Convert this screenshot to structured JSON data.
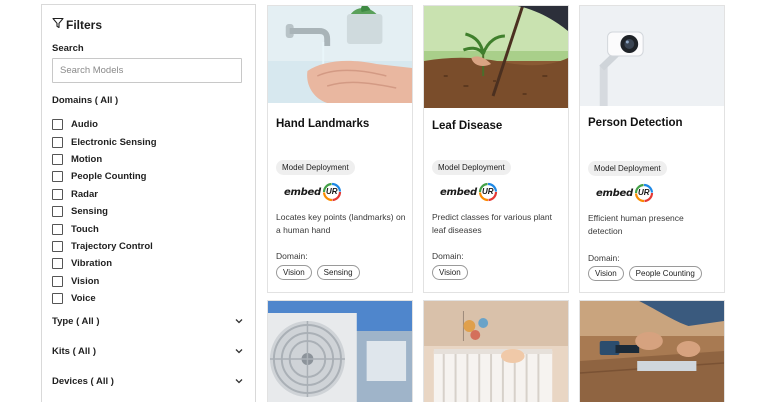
{
  "sidebar": {
    "title": "Filters",
    "search_label": "Search",
    "search_placeholder": "Search Models",
    "domains_heading": "Domains ( All )",
    "domains": [
      "Audio",
      "Electronic Sensing",
      "Motion",
      "People Counting",
      "Radar",
      "Sensing",
      "Touch",
      "Trajectory Control",
      "Vibration",
      "Vision",
      "Voice"
    ],
    "type_label": "Type ( All )",
    "kits_label": "Kits ( All )",
    "devices_label": "Devices ( All )"
  },
  "cards": [
    {
      "title": "Hand Landmarks",
      "tag": "Model Deployment",
      "logo_text": "embed",
      "logo_mark": "UR",
      "description": "Locates key points (landmarks) on a human hand",
      "domain_label": "Domain:",
      "domains": [
        "Vision",
        "Sensing"
      ]
    },
    {
      "title": "Leaf Disease",
      "tag": "Model Deployment",
      "logo_text": "embed",
      "logo_mark": "UR",
      "description": "Predict classes for various plant leaf diseases",
      "domain_label": "Domain:",
      "domains": [
        "Vision"
      ]
    },
    {
      "title": "Person Detection",
      "tag": "Model Deployment",
      "logo_text": "embed",
      "logo_mark": "UR",
      "description": "Efficient human presence detection",
      "domain_label": "Domain:",
      "domains": [
        "Vision",
        "People Counting"
      ]
    }
  ],
  "colors": {
    "border": "#d9d9d9",
    "tag_bg": "#efefef",
    "logo_ring": [
      "#e53935",
      "#fb8c00",
      "#43a047",
      "#1e88e5"
    ]
  }
}
